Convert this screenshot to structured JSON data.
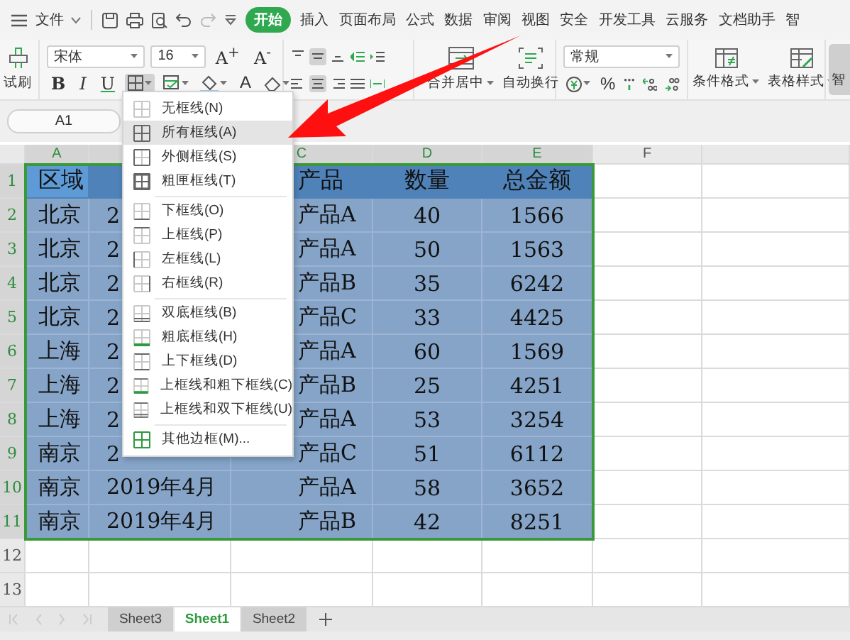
{
  "menubar": {
    "file_label": "文件",
    "tabs": [
      {
        "label": "开始",
        "selected": true
      },
      {
        "label": "插入",
        "selected": false
      },
      {
        "label": "页面布局",
        "selected": false
      },
      {
        "label": "公式",
        "selected": false
      },
      {
        "label": "数据",
        "selected": false
      },
      {
        "label": "审阅",
        "selected": false
      },
      {
        "label": "视图",
        "selected": false
      },
      {
        "label": "安全",
        "selected": false
      },
      {
        "label": "开发工具",
        "selected": false
      },
      {
        "label": "云服务",
        "selected": false
      },
      {
        "label": "文档助手",
        "selected": false
      },
      {
        "label": "智",
        "selected": false
      }
    ]
  },
  "ribbon": {
    "painter_label": "试刷",
    "font_name": "宋体",
    "font_size": "16",
    "size_buttons": [
      "A$^{+}$",
      "A$^{-}$"
    ],
    "style_buttons": [
      "B",
      "I",
      "U"
    ],
    "border_button": {
      "pressed": true
    },
    "font_color_label": "A",
    "align_top": [
      {
        "pressed": false
      },
      {
        "pressed": true
      },
      {
        "pressed": false
      },
      {
        "pressed": false
      },
      {
        "pressed": false
      }
    ],
    "align_bottom": [
      {
        "pressed": false
      },
      {
        "pressed": true
      },
      {
        "pressed": false
      },
      {
        "pressed": false
      },
      {
        "pressed": false
      }
    ],
    "merge_label": "合并居中",
    "wrap_label": "自动换行",
    "number_format": "常规",
    "percent_label": "%",
    "conditional_label": "条件格式",
    "table_style_label": "表格样式",
    "smart_label": "智"
  },
  "name_box": "A1",
  "columns": [
    {
      "label": "A",
      "selected": true
    },
    {
      "selected": true
    },
    {
      "label": "C",
      "selected": true
    },
    {
      "label": "D",
      "selected": true
    },
    {
      "label": "E",
      "selected": true
    },
    {
      "label": "F",
      "selected": false
    },
    {
      "selected": false
    }
  ],
  "rows": [
    {
      "header": "1",
      "selected": true,
      "kind": "header",
      "active": true,
      "cells": {
        "A": "区域",
        "C": "产品",
        "D": "数量",
        "E": "总金额"
      }
    },
    {
      "header": "2",
      "selected": true,
      "kind": "data",
      "active": false,
      "cells": {
        "A": "北京",
        "B": "2",
        "C": "产品A",
        "D": "40",
        "E": "1566"
      }
    },
    {
      "header": "3",
      "selected": true,
      "kind": "data",
      "active": false,
      "cells": {
        "A": "北京",
        "B": "2",
        "C": "产品A",
        "D": "50",
        "E": "1563"
      }
    },
    {
      "header": "4",
      "selected": true,
      "kind": "data",
      "active": false,
      "cells": {
        "A": "北京",
        "B": "2",
        "C": "产品B",
        "D": "35",
        "E": "6242"
      }
    },
    {
      "header": "5",
      "selected": true,
      "kind": "data",
      "active": false,
      "cells": {
        "A": "北京",
        "B": "2",
        "C": "产品C",
        "D": "33",
        "E": "4425"
      }
    },
    {
      "header": "6",
      "selected": true,
      "kind": "data",
      "active": false,
      "cells": {
        "A": "上海",
        "B": "2",
        "C": "产品A",
        "D": "60",
        "E": "1569"
      }
    },
    {
      "header": "7",
      "selected": true,
      "kind": "data",
      "active": false,
      "cells": {
        "A": "上海",
        "B": "2",
        "C": "产品B",
        "D": "25",
        "E": "4251"
      }
    },
    {
      "header": "8",
      "selected": true,
      "kind": "data",
      "active": false,
      "cells": {
        "A": "上海",
        "B": "2",
        "C": "产品A",
        "D": "53",
        "E": "3254"
      }
    },
    {
      "header": "9",
      "selected": true,
      "kind": "data",
      "active": false,
      "cells": {
        "A": "南京",
        "B": "2",
        "C": "产品C",
        "D": "51",
        "E": "6112"
      }
    },
    {
      "header": "10",
      "selected": true,
      "kind": "data",
      "active": false,
      "cells": {
        "A": "南京",
        "B": "2019年4月",
        "C": "产品A",
        "D": "58",
        "E": "3652"
      }
    },
    {
      "header": "11",
      "selected": true,
      "kind": "data",
      "active": false,
      "cells": {
        "A": "南京",
        "B": "2019年4月",
        "C": "产品B",
        "D": "42",
        "E": "8251"
      }
    },
    {
      "header": "12",
      "selected": false,
      "kind": "data",
      "active": false
    },
    {
      "header": "13",
      "selected": false,
      "kind": "data",
      "active": false
    }
  ],
  "border_menu": {
    "items": [
      {
        "label": "无框线(N)",
        "kind": "none",
        "selected": false,
        "separator_before": false
      },
      {
        "label": "所有框线(A)",
        "kind": "all",
        "selected": true,
        "separator_before": false
      },
      {
        "label": "外侧框线(S)",
        "kind": "outside",
        "selected": false,
        "separator_before": false
      },
      {
        "label": "粗匣框线(T)",
        "kind": "thick-box",
        "selected": false,
        "separator_before": false
      },
      {
        "label": "下框线(O)",
        "kind": "bottom",
        "selected": false,
        "separator_before": true
      },
      {
        "label": "上框线(P)",
        "kind": "top",
        "selected": false,
        "separator_before": false
      },
      {
        "label": "左框线(L)",
        "kind": "left",
        "selected": false,
        "separator_before": false
      },
      {
        "label": "右框线(R)",
        "kind": "right",
        "selected": false,
        "separator_before": false
      },
      {
        "label": "双底框线(B)",
        "kind": "double-bottom",
        "selected": false,
        "separator_before": true
      },
      {
        "label": "粗底框线(H)",
        "kind": "thick-bottom",
        "selected": false,
        "separator_before": false
      },
      {
        "label": "上下框线(D)",
        "kind": "top-bottom",
        "selected": false,
        "separator_before": false
      },
      {
        "label": "上框线和粗下框线(C)",
        "kind": "top-thick-bottom",
        "selected": false,
        "separator_before": false
      },
      {
        "label": "上框线和双下框线(U)",
        "kind": "top-double-bottom",
        "selected": false,
        "separator_before": false
      },
      {
        "label": "其他边框(M)...",
        "kind": "more",
        "selected": false,
        "separator_before": true
      }
    ]
  },
  "sheet_tabs": [
    {
      "label": "Sheet3",
      "selected": false
    },
    {
      "label": "Sheet1",
      "selected": true
    },
    {
      "label": "Sheet2",
      "selected": false
    }
  ],
  "annotation": {
    "kind": "arrow"
  }
}
